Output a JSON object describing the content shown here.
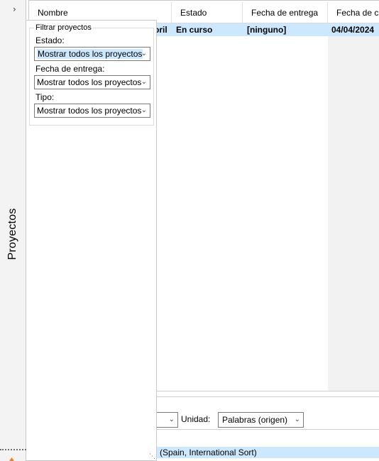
{
  "sidebar": {
    "expand_icon": "chevron-right-icon",
    "expand_glyph": "›",
    "panel_title": "Proyectos"
  },
  "list": {
    "columns": [
      "Nombre",
      "Estado",
      "Fecha de entrega",
      "Fecha de cre"
    ],
    "selected_row": {
      "name_tail": "bril",
      "status": "En curso",
      "due": "[ninguno]",
      "created": "04/04/2024"
    }
  },
  "toolbar": {
    "unit_label": "Unidad:",
    "unit_value": "Palabras (origen)"
  },
  "statusbar": {
    "text": "n (Spain, International Sort)"
  },
  "filter": {
    "title": "Filtrar proyectos",
    "estado_label": "Estado:",
    "estado_value": "Mostrar todos los proyectos",
    "fecha_label": "Fecha de entrega:",
    "fecha_value": "Mostrar todos los proyectos",
    "tipo_label": "Tipo:",
    "tipo_value": "Mostrar todos los proyectos"
  },
  "colors": {
    "selection": "#cce8ff",
    "accent": "#e8812b"
  }
}
